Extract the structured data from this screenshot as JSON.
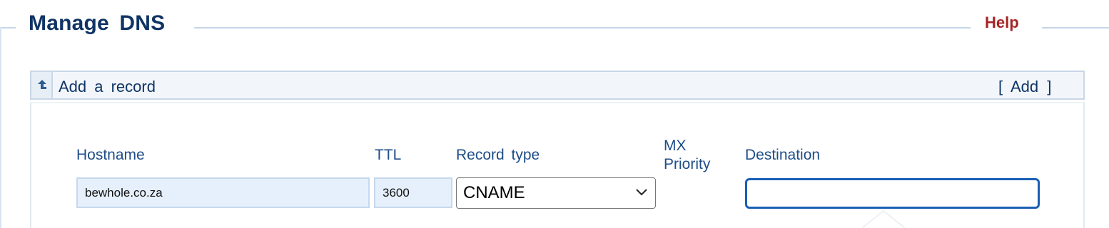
{
  "header": {
    "title": "Manage DNS",
    "help_label": "Help"
  },
  "add_bar": {
    "label": "Add a record",
    "action_label": "[ Add ]",
    "icon": "arrow-up-icon"
  },
  "form": {
    "hostname": {
      "label": "Hostname",
      "value": "bewhole.co.za",
      "placeholder": ""
    },
    "ttl": {
      "label": "TTL",
      "value": "3600",
      "placeholder": ""
    },
    "record_type": {
      "label": "Record type",
      "selected": "CNAME",
      "icon": "chevron-down-icon"
    },
    "mx_priority": {
      "label_line1": "MX",
      "label_line2": "Priority"
    },
    "destination": {
      "label": "Destination",
      "value": "",
      "placeholder": ""
    }
  },
  "colors": {
    "title": "#0f3464",
    "help": "#a52424",
    "label": "#1f4d87",
    "input_bg": "#e6f0fc",
    "focus_border": "#1a5fb4"
  }
}
